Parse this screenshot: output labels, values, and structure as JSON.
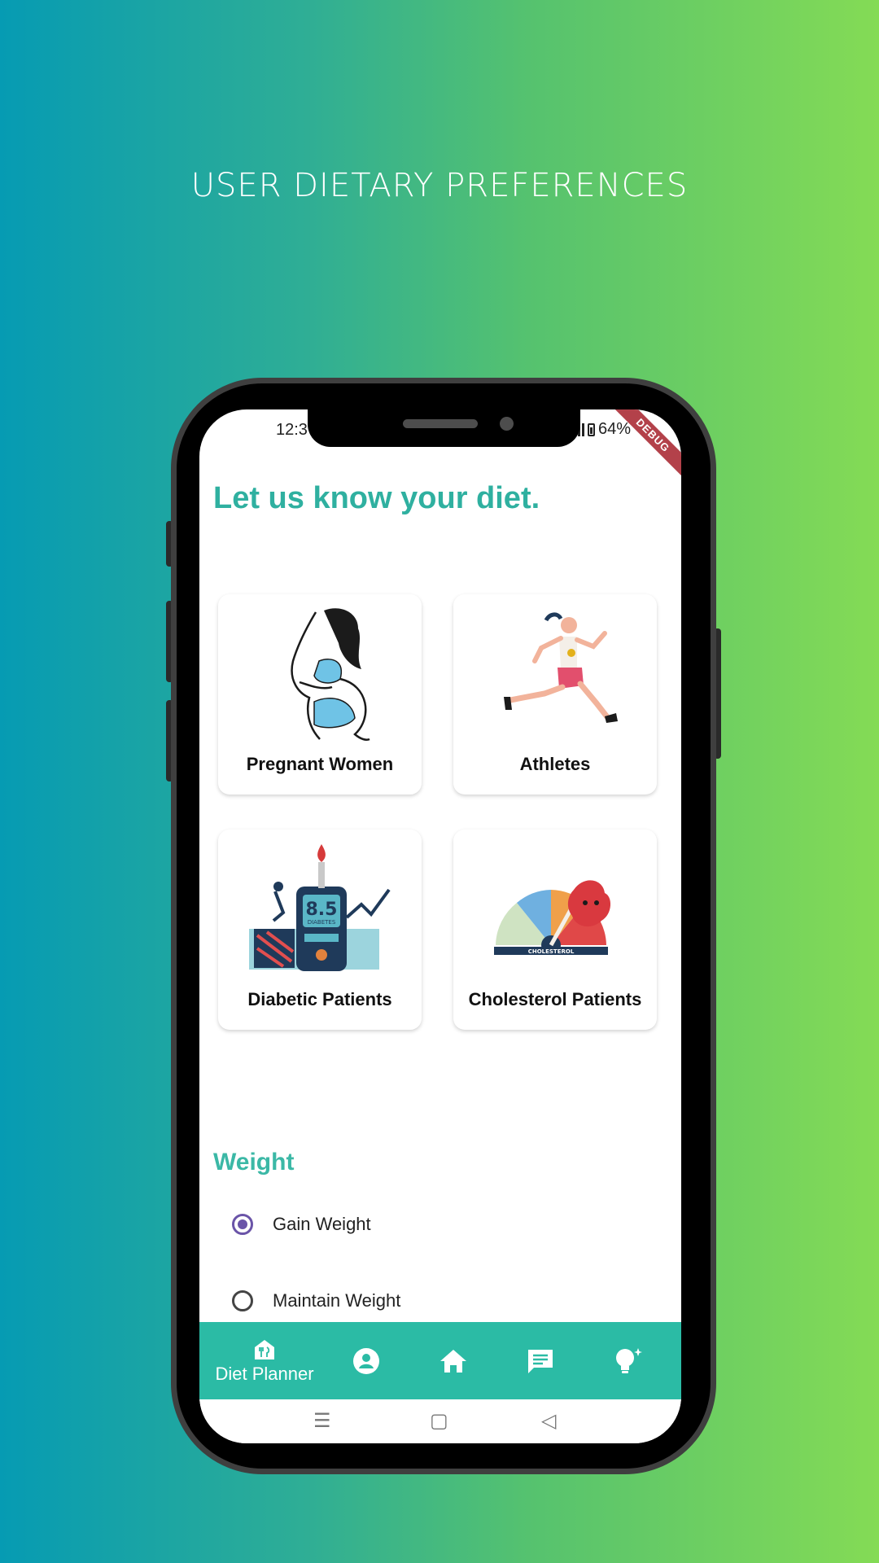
{
  "promo": {
    "title": "USER DIETARY PREFERENCES"
  },
  "status_bar": {
    "time": "12:3",
    "battery": "64%",
    "debug_label": "DEBUG"
  },
  "page": {
    "heading": "Let us know your diet."
  },
  "categories": [
    {
      "label": "Pregnant Women",
      "icon": "pregnant-woman-illustration"
    },
    {
      "label": "Athletes",
      "icon": "running-athlete-illustration"
    },
    {
      "label": "Diabetic Patients",
      "icon": "glucose-meter-illustration"
    },
    {
      "label": "Cholesterol Patients",
      "icon": "cholesterol-gauge-illustration"
    }
  ],
  "diabetes_illustration": {
    "reading": "8.5",
    "caption": "DIABETES"
  },
  "cholesterol_illustration": {
    "caption": "CHOLESTEROL"
  },
  "weight": {
    "title": "Weight",
    "options": [
      {
        "label": "Gain Weight",
        "selected": true
      },
      {
        "label": "Maintain Weight",
        "selected": false
      }
    ]
  },
  "bottom_nav": {
    "active_label": "Diet Planner",
    "items": [
      "diet-planner-icon",
      "profile-icon",
      "home-icon",
      "chat-icon",
      "lightbulb-icon"
    ]
  },
  "colors": {
    "accent": "#2fb0a0",
    "nav": "#2bbba5",
    "radio": "#6a54a8",
    "debug": "#b3414a"
  }
}
